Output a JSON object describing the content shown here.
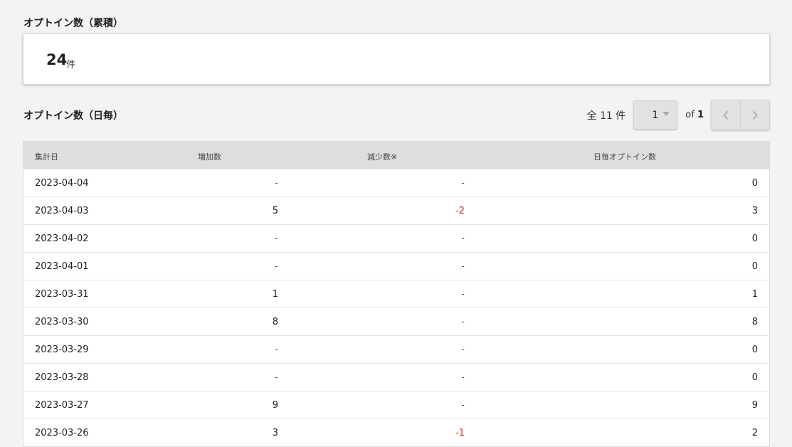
{
  "cumulative": {
    "title": "オプトイン数（累積）",
    "value": "24",
    "unit": "件"
  },
  "daily": {
    "title": "オプトイン数（日毎）",
    "pager": {
      "total_text": "全 11 件",
      "current_page": "1",
      "of_label": "of",
      "total_pages": "1"
    },
    "table": {
      "headers": [
        "集計日",
        "増加数",
        "減少数※",
        "日毎オプトイン数"
      ],
      "rows": [
        {
          "date": "2023-04-04",
          "increase": "-",
          "decrease": "-",
          "daily": "0"
        },
        {
          "date": "2023-04-03",
          "increase": "5",
          "decrease": "-2",
          "daily": "3"
        },
        {
          "date": "2023-04-02",
          "increase": "-",
          "decrease": "-",
          "daily": "0"
        },
        {
          "date": "2023-04-01",
          "increase": "-",
          "decrease": "-",
          "daily": "0"
        },
        {
          "date": "2023-03-31",
          "increase": "1",
          "decrease": "-",
          "daily": "1"
        },
        {
          "date": "2023-03-30",
          "increase": "8",
          "decrease": "-",
          "daily": "8"
        },
        {
          "date": "2023-03-29",
          "increase": "-",
          "decrease": "-",
          "daily": "0"
        },
        {
          "date": "2023-03-28",
          "increase": "-",
          "decrease": "-",
          "daily": "0"
        },
        {
          "date": "2023-03-27",
          "increase": "9",
          "decrease": "-",
          "daily": "9"
        },
        {
          "date": "2023-03-26",
          "increase": "3",
          "decrease": "-1",
          "daily": "2"
        }
      ]
    }
  },
  "colors": {
    "negative": "#e0242c",
    "background": "#f3f3f3",
    "header": "#dedede"
  },
  "icons": {
    "prev": "chevron-left-icon",
    "next": "chevron-right-icon",
    "dropdown": "caret-down-icon"
  }
}
